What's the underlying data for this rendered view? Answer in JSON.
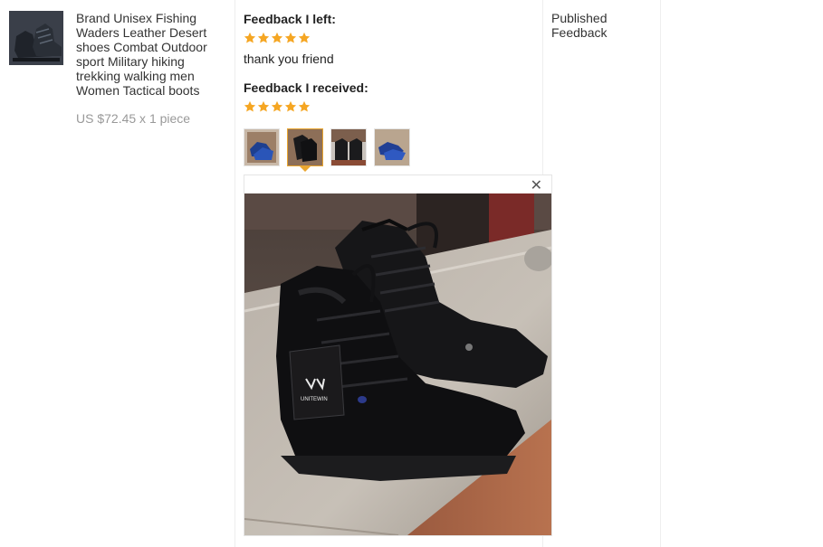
{
  "product": {
    "image_icon": "boots-thumbnail",
    "title": "Brand Unisex Fishing Waders Leather Desert shoes Combat Outdoor sport Military hiking trekking walking men Women Tactical boots",
    "price": "US $72.45 x 1 piece"
  },
  "feedback_left": {
    "heading": "Feedback I left:",
    "rating": 5,
    "text": "thank you friend"
  },
  "feedback_received": {
    "heading": "Feedback I received:",
    "rating": 5,
    "photos": [
      {
        "icon": "blue-shoes-photo",
        "active": false
      },
      {
        "icon": "black-boots-photo",
        "active": true
      },
      {
        "icon": "black-boots-pair-photo",
        "active": false
      },
      {
        "icon": "blue-shoes-photo",
        "active": false
      }
    ]
  },
  "viewer": {
    "close_label": "✕",
    "tag_brand": "UNITEWIN"
  },
  "status": {
    "label": "Published Feedback"
  },
  "colors": {
    "star": "#f5a623",
    "active_border": "#e9a630",
    "price": "#999999"
  }
}
